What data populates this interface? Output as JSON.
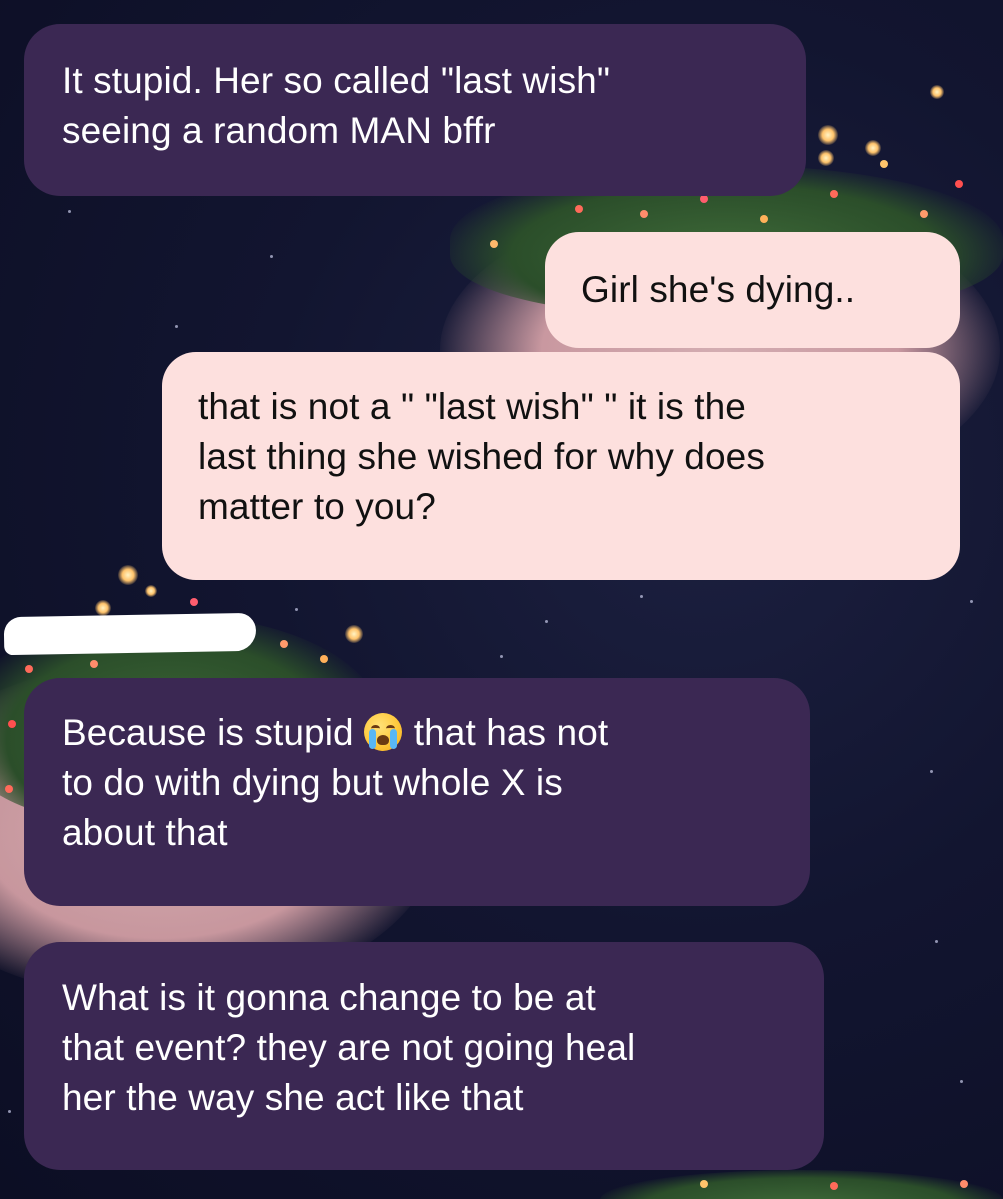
{
  "conversation": {
    "messages": [
      {
        "direction": "incoming",
        "lines": [
          "It stupid. Her so called \"last wish\"",
          "seeing a random MAN bffr"
        ]
      },
      {
        "direction": "outgoing",
        "lines": [
          "Girl she's dying.."
        ]
      },
      {
        "direction": "outgoing",
        "lines": [
          "that is not a \" \"last wish\" \" it is the",
          "last thing she wished for why does",
          "matter to you?"
        ]
      },
      {
        "direction": "incoming",
        "lines": [
          "Because is stupid",
          "that has not",
          "to do with dying but whole X is",
          "about that"
        ],
        "emoji": "loudly-crying-face-icon"
      },
      {
        "direction": "incoming",
        "lines": [
          "What is it gonna change to be at",
          "that event? they are not going heal",
          "her the way she act like that"
        ]
      }
    ]
  },
  "colors": {
    "incoming_bubble": "#3b2853",
    "outgoing_bubble": "#fde0de",
    "background": "#121530"
  }
}
